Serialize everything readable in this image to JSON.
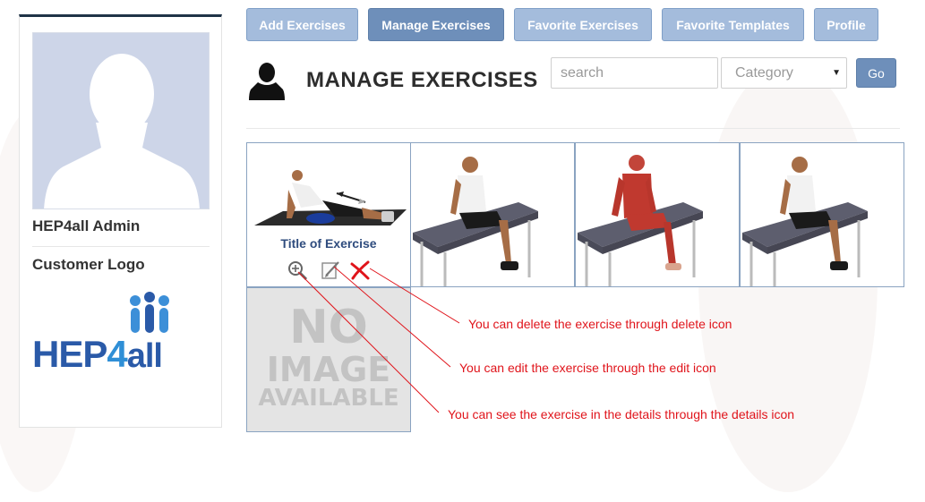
{
  "tabs": [
    {
      "label": "Add Exercises",
      "active": false
    },
    {
      "label": "Manage Exercises",
      "active": true
    },
    {
      "label": "Favorite Exercises",
      "active": false
    },
    {
      "label": "Favorite Templates",
      "active": false
    },
    {
      "label": "Profile",
      "active": false
    }
  ],
  "sidebar": {
    "admin_name": "HEP4all Admin",
    "logo_title": "Customer Logo",
    "logo": {
      "part1": "HEP",
      "part2": "4",
      "part3": "all"
    }
  },
  "header": {
    "title": "MANAGE EXERCISES",
    "search_placeholder": "search",
    "category_value": "Category",
    "go_label": "Go",
    "icon": "user-silhouette-icon"
  },
  "grid": {
    "first_item_title": "Title of Exercise",
    "actions": [
      "zoom-details-icon",
      "edit-icon",
      "delete-icon"
    ],
    "no_image": {
      "line1": "NO",
      "line2": "IMAGE",
      "line3": "AVAILABLE"
    }
  },
  "annotations": {
    "delete": "You can delete the exercise through delete icon",
    "edit": "You can edit the exercise through the edit icon",
    "details": "You can see the exercise in the details through the details icon"
  },
  "colors": {
    "tab": "#a4bcdc",
    "tab_active": "#6e8fba",
    "sidebar_top": "#1f3347",
    "annotation": "#e0141b",
    "title_link": "#2f4c7e"
  }
}
